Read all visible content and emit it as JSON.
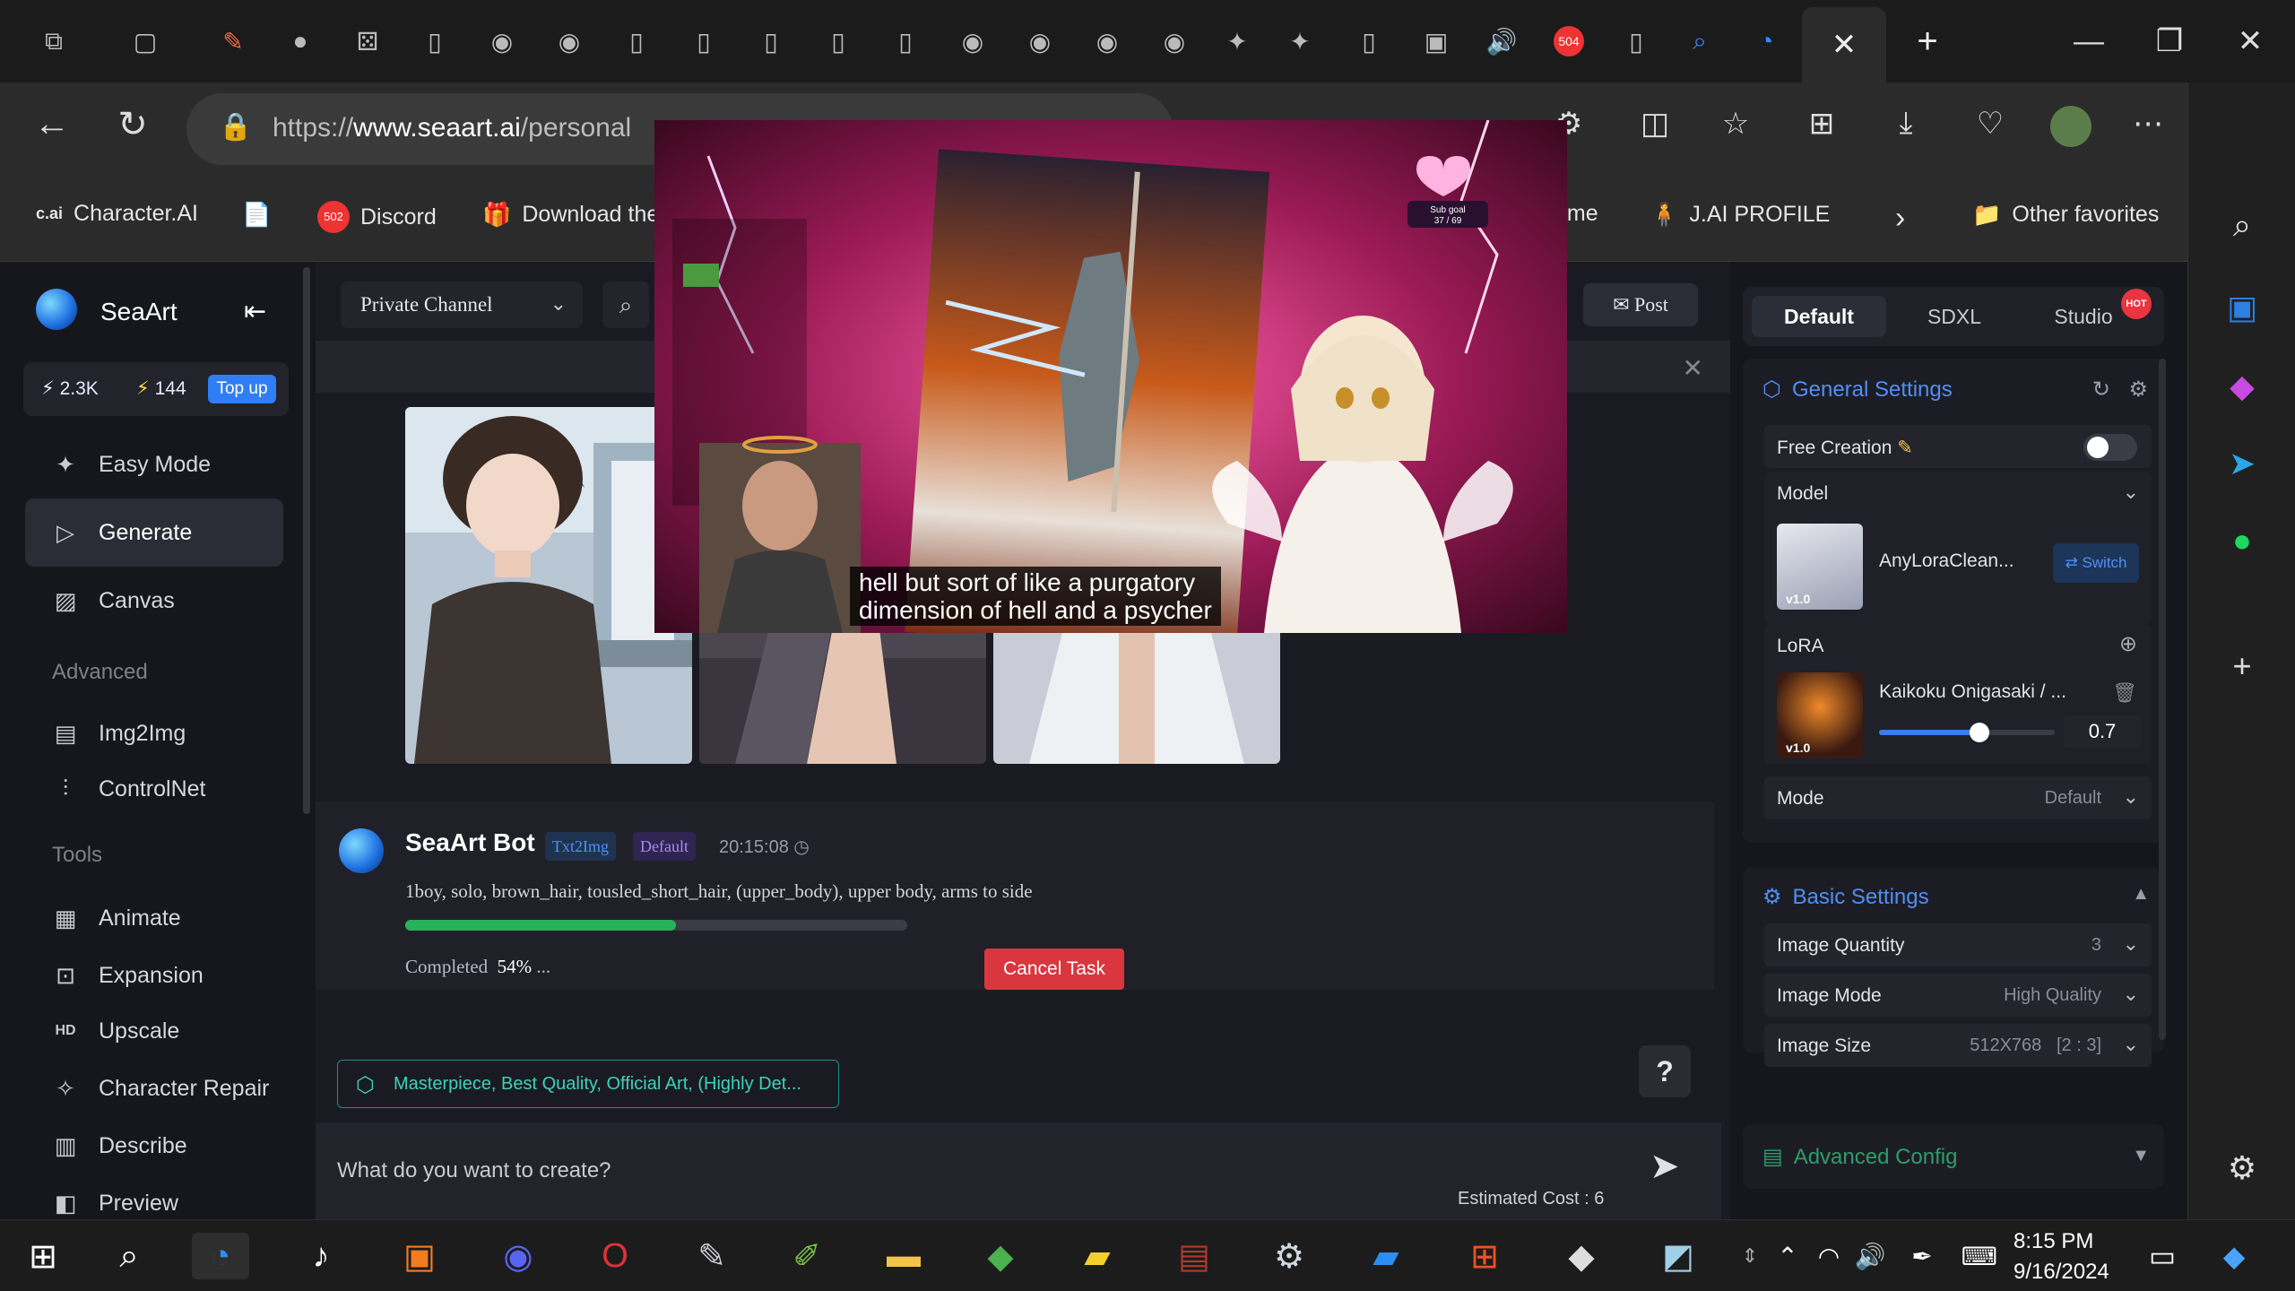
{
  "browser": {
    "url_prefix": "https://",
    "url_host": "www.seaart.ai",
    "url_path": "/personal",
    "tab_badges": {
      "discord_tab": "504"
    },
    "close_tab": "✕",
    "new_tab": "+",
    "window_controls": {
      "minimize": "—",
      "restore": "❐",
      "close": "✕"
    }
  },
  "favorites": {
    "items": [
      {
        "label": "Character.AI",
        "icon": "c.ai"
      },
      {
        "label": "",
        "icon": "📄"
      },
      {
        "label": "Discord",
        "icon": "502"
      },
      {
        "label": "Download the",
        "icon": "🎁"
      },
      {
        "label": "ome",
        "icon": ""
      },
      {
        "label": "J.AI PROFILE",
        "icon": "🧍"
      }
    ],
    "more": "›",
    "other": "Other favorites"
  },
  "seaart": {
    "brand": "SeaArt",
    "credits": {
      "stamina": "2.3K",
      "power": "144",
      "topup": "Top up"
    },
    "nav": {
      "easy_mode": "Easy Mode",
      "generate": "Generate",
      "canvas": "Canvas",
      "advanced_section": "Advanced",
      "img2img": "Img2Img",
      "controlnet": "ControlNet",
      "tools_section": "Tools",
      "animate": "Animate",
      "expansion": "Expansion",
      "upscale": "Upscale",
      "character_repair": "Character Repair",
      "describe": "Describe",
      "preview": "Preview"
    },
    "channel": "Private Channel",
    "post": "Post",
    "bot": {
      "name": "SeaArt Bot",
      "badge_model": "Txt2Img",
      "badge_mode": "Default",
      "time": "20:15:08",
      "prompt": "1boy, solo, brown_hair, tousled_short_hair, (upper_body), upper body, arms to side",
      "completed_label": "Completed",
      "progress_text": "54%",
      "progress_ellipsis": "...",
      "progress": 0.54,
      "cancel": "Cancel Task"
    },
    "tag_pill": "Masterpiece, Best Quality, Official Art, (Highly Det...",
    "help": "?",
    "prompt_placeholder": "What do you want to create?",
    "estimated_cost": "Estimated Cost : 6",
    "panel": {
      "tabs": [
        "Default",
        "SDXL",
        "Studio"
      ],
      "hot": "HOT",
      "general_settings": "General Settings",
      "free_creation": "Free Creation",
      "model_label": "Model",
      "model_name": "AnyLoraClean...",
      "model_version": "v1.0",
      "switch": "Switch",
      "lora_label": "LoRA",
      "lora_name": "Kaikoku Onigasaki / ...",
      "lora_version": "v1.0",
      "lora_weight": "0.7",
      "lora_weight_fraction": 0.57,
      "mode_label": "Mode",
      "mode_value": "Default",
      "basic_settings": "Basic Settings",
      "image_quantity_label": "Image Quantity",
      "image_quantity_value": "3",
      "image_mode_label": "Image Mode",
      "image_mode_value": "High Quality",
      "image_size_label": "Image Size",
      "image_size_value": "512X768   [2 : 3]",
      "advanced_config": "Advanced Config"
    }
  },
  "video": {
    "subtitle_line1": "hell but sort of like a purgatory",
    "subtitle_line2": "dimension of hell and a psycher",
    "sub_goal": "Sub goal",
    "sub_goal_count": "37 / 69"
  },
  "taskbar": {
    "time": "8:15 PM",
    "date": "9/16/2024"
  }
}
